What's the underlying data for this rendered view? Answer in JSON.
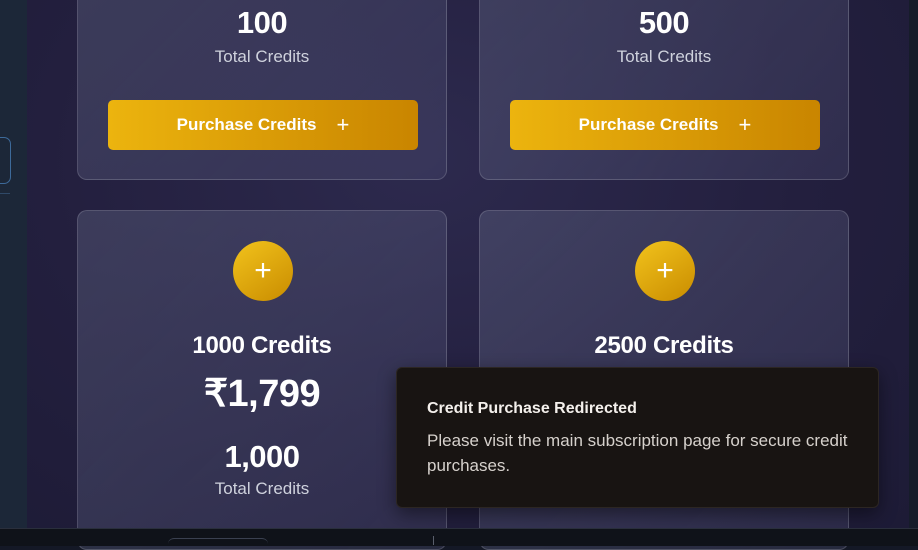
{
  "packages": [
    {
      "total": "100",
      "total_label": "Total Credits",
      "button_label": "Purchase Credits"
    },
    {
      "total": "500",
      "total_label": "Total Credits",
      "button_label": "Purchase Credits"
    },
    {
      "title": "1000 Credits",
      "price": "₹1,799",
      "total": "1,000",
      "total_label": "Total Credits"
    },
    {
      "title": "2500 Credits"
    }
  ],
  "icons": {
    "plus": "+"
  },
  "toast": {
    "title": "Credit Purchase Redirected",
    "description": "Please visit the main subscription page for secure credit purchases."
  },
  "colors": {
    "accent_gold": "#ecb40e",
    "accent_gold_dark": "#c98500",
    "toast_background": "#181412"
  }
}
